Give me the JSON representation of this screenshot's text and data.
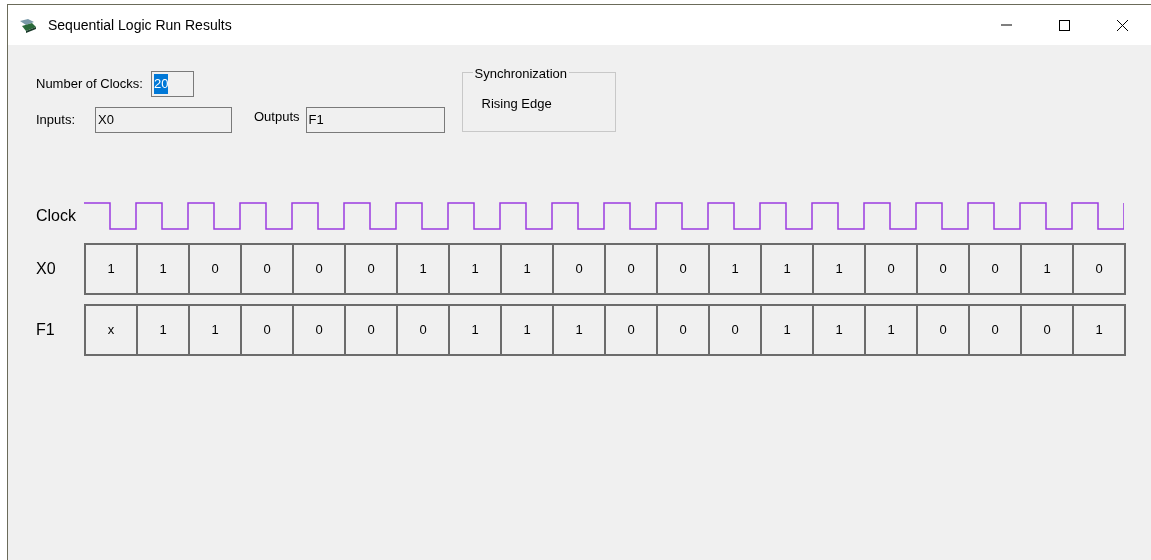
{
  "window": {
    "title": "Sequential Logic Run Results"
  },
  "number_of_clocks": {
    "label": "Number of Clocks:",
    "value": "20",
    "text_selected": true
  },
  "inputs": {
    "label": "Inputs:",
    "value": "X0"
  },
  "outputs": {
    "label": "Outputs",
    "value": "F1"
  },
  "synchronization": {
    "title": "Synchronization",
    "value": "Rising Edge"
  },
  "clock": {
    "label": "Clock"
  },
  "signals": [
    {
      "name": "X0",
      "values": [
        "1",
        "1",
        "0",
        "0",
        "0",
        "0",
        "1",
        "1",
        "1",
        "0",
        "0",
        "0",
        "1",
        "1",
        "1",
        "0",
        "0",
        "0",
        "1",
        "0"
      ]
    },
    {
      "name": "F1",
      "values": [
        "x",
        "1",
        "1",
        "0",
        "0",
        "0",
        "0",
        "1",
        "1",
        "1",
        "0",
        "0",
        "0",
        "1",
        "1",
        "1",
        "0",
        "0",
        "0",
        "1"
      ]
    }
  ]
}
